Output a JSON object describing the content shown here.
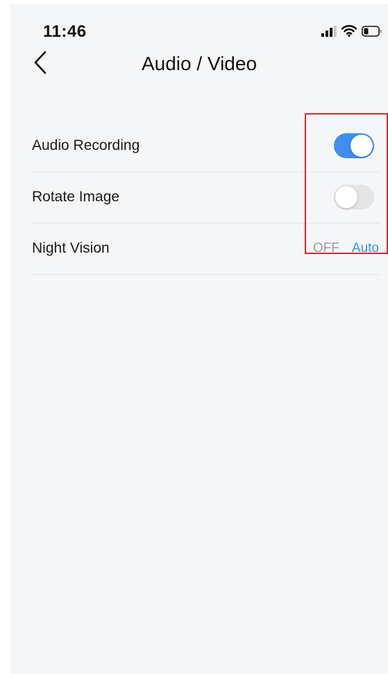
{
  "status_bar": {
    "time": "11:46",
    "icons": [
      "cellular-signal-icon",
      "wifi-icon",
      "battery-icon"
    ]
  },
  "nav": {
    "back_icon": "chevron-left-icon",
    "title": "Audio / Video"
  },
  "settings": [
    {
      "label": "Audio Recording",
      "control": "toggle",
      "state": "on"
    },
    {
      "label": "Rotate Image",
      "control": "toggle",
      "state": "off"
    },
    {
      "label": "Night Vision",
      "control": "segmented",
      "options": [
        "OFF",
        "Auto"
      ],
      "selected": "Auto"
    }
  ],
  "colors": {
    "accent": "#3d8ef0",
    "toggle_off": "#e4e5e7",
    "background": "#f5f6f8",
    "highlight_box": "#e0242b"
  }
}
